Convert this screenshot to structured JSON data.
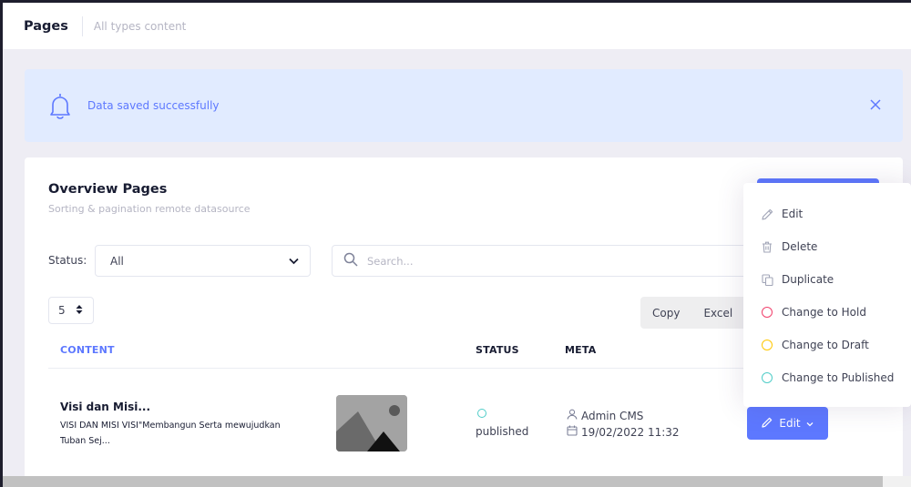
{
  "header": {
    "title": "Pages",
    "subtitle": "All types content"
  },
  "alert": {
    "message": "Data saved successfully",
    "icon": "bell-icon",
    "close_icon": "close-icon"
  },
  "card": {
    "title": "Overview Pages",
    "subtitle": "Sorting & pagination remote datasource"
  },
  "filters": {
    "status_label": "Status:",
    "status_value": "All",
    "search_placeholder": "Search..."
  },
  "pager": {
    "page_size": "5"
  },
  "export": {
    "copy_label": "Copy",
    "excel_label": "Excel"
  },
  "table": {
    "columns": [
      "CONTENT",
      "STATUS",
      "META"
    ],
    "rows": [
      {
        "title": "Visi dan Misi...",
        "description": "VISI DAN MISI VISI\"Membangun Serta mewujudkan Tuban Sej...",
        "status": "published",
        "author": "Admin CMS",
        "date": "19/02/2022 11:32",
        "action_label": "Edit"
      }
    ]
  },
  "dropdown": {
    "items": [
      {
        "label": "Edit",
        "icon": "pencil-icon"
      },
      {
        "label": "Delete",
        "icon": "trash-icon"
      },
      {
        "label": "Duplicate",
        "icon": "copy-icon"
      },
      {
        "label": "Change to Hold",
        "icon": "circle-icon",
        "color": "#f1416c"
      },
      {
        "label": "Change to Draft",
        "icon": "circle-icon",
        "color": "#ffc700"
      },
      {
        "label": "Change to Published",
        "icon": "circle-icon",
        "color": "#50cdc8"
      }
    ]
  },
  "colors": {
    "primary": "#5d78ff",
    "alert_bg": "#e1ebff",
    "published": "#50cdc8"
  }
}
